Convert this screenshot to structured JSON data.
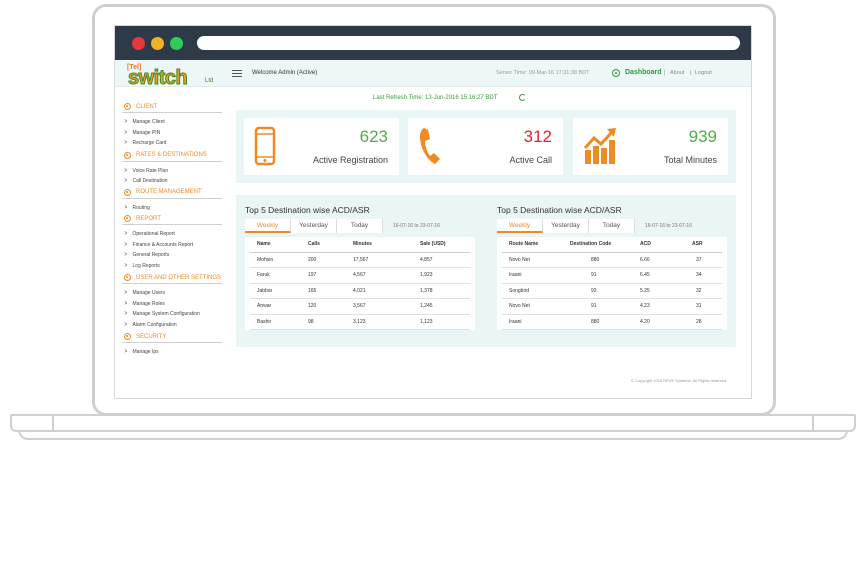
{
  "app": {
    "logo_tel": "[Tel]",
    "logo_name": "switch",
    "logo_suffix": "Ltd"
  },
  "header": {
    "welcome": "Welcome Admin (Active)",
    "server_time": "Server Time: 09-Mar-16  17:31:38 BDT",
    "dashboard": "Dashboard",
    "about": "About",
    "logout": "Logout"
  },
  "sidebar": {
    "sections": [
      {
        "label": "CLIENT",
        "items": [
          "Manage Client",
          "Manage PIN",
          "Recharge Card"
        ]
      },
      {
        "label": "RATES & DESTINATIONS",
        "items": [
          "Voice Rate Plan",
          "Call  Destination"
        ]
      },
      {
        "label": "ROUTE MANAGEMENT",
        "items": [
          "Routing"
        ]
      },
      {
        "label": "REPORT",
        "items": [
          "Operational Report",
          "Finance & Accounts Report",
          "General Reports",
          "Log Reports"
        ]
      },
      {
        "label": "USER AND OTHER SETTINGS",
        "items": [
          "Manage Users",
          "Manage Roles",
          "Manage System Configuration",
          "Alarm Configuration"
        ]
      },
      {
        "label": "SECURITY",
        "items": [
          "Manage Ips"
        ]
      }
    ]
  },
  "main": {
    "refresh": "Last Refresh Time: 13-Jun-2016 15:16:27 BDT",
    "stats": [
      {
        "value": "623",
        "label": "Active Registration",
        "color": "#4fae4a",
        "icon": "mobile-phone-icon"
      },
      {
        "value": "312",
        "label": "Active Call",
        "color": "#e0262d",
        "icon": "telephone-handset-icon"
      },
      {
        "value": "939",
        "label": "Total Minutes",
        "color": "#4fae4a",
        "icon": "growth-chart-icon"
      }
    ],
    "table_left": {
      "title": "Top 5 Destination wise ACD/ASR",
      "tabs": [
        "Weekly",
        "Yesterday",
        "Today"
      ],
      "range": "16-07-16 to 23-07-16",
      "headers": [
        "Name",
        "Calls",
        "Minutes",
        "Sale (USD)"
      ],
      "rows": [
        [
          "Mohsin",
          "200",
          "17,567",
          "4,857"
        ],
        [
          "Faruk",
          "197",
          "4,567",
          "1,923"
        ],
        [
          "Jabbar",
          "165",
          "4,021",
          "1,378"
        ],
        [
          "Anwar",
          "120",
          "3,567",
          "1,245"
        ],
        [
          "Bashir",
          "98",
          "3,123",
          "1,123"
        ]
      ]
    },
    "table_right": {
      "title": "Top 5 Destination wise ACD/ASR",
      "tabs": [
        "Weekly",
        "Yesterday",
        "Today"
      ],
      "range": "16-07-16 to 23-07-16",
      "headers": [
        "Route Name",
        "Destination Code",
        "ACD",
        "ASR"
      ],
      "rows": [
        [
          "Novo Net",
          "880",
          "6.66",
          "37"
        ],
        [
          "Iraani",
          "91",
          "6.45",
          "34"
        ],
        [
          "Songbird",
          "92",
          "5.25",
          "32"
        ],
        [
          "Novo Net",
          "91",
          "4.23",
          "31"
        ],
        [
          "Iraani",
          "880",
          "4.20",
          "28"
        ]
      ]
    },
    "copyright": "© Copyright 2016 REVE Systems. All Rights reserved."
  }
}
